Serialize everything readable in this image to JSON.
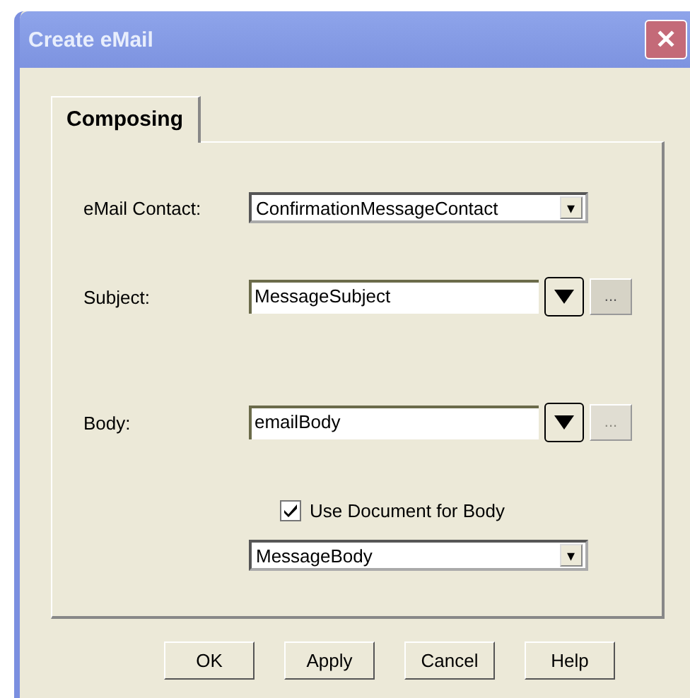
{
  "window": {
    "title": "Create eMail",
    "close": "✕"
  },
  "tabs": [
    {
      "label": "Composing",
      "selected": true
    }
  ],
  "fields": [
    {
      "kind": "dropdown",
      "label": "eMail Contact:",
      "value": "ConfirmationMessageContact",
      "arrow": "▾"
    },
    {
      "kind": "picker",
      "label": "Subject:",
      "value": "MessageSubject",
      "browse": "...",
      "browse_disabled": false
    },
    {
      "kind": "picker",
      "label": "Body:",
      "value": "emailBody",
      "browse": "...",
      "browse_disabled": true
    }
  ],
  "use_document": {
    "label": "Use Document for Body",
    "checked": true
  },
  "document_dropdown": {
    "value": "MessageBody",
    "arrow": "▾"
  },
  "buttons": [
    "OK",
    "Apply",
    "Cancel",
    "Help"
  ]
}
